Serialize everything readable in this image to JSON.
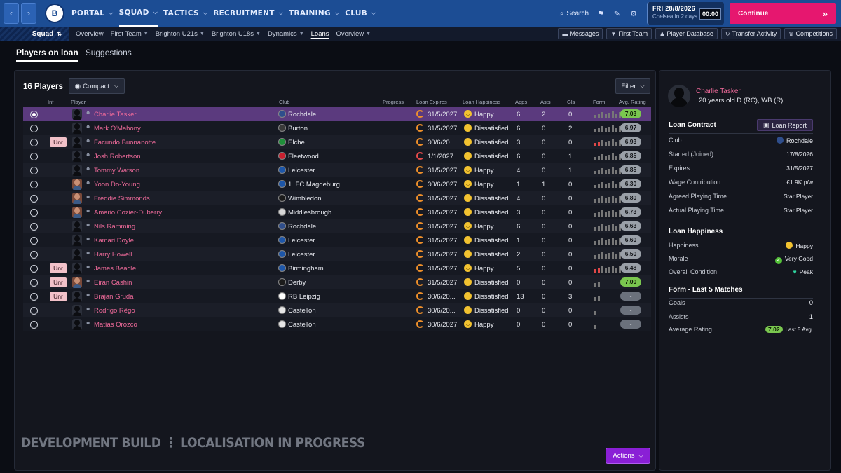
{
  "topnav": {
    "menu": [
      {
        "label": "PORTAL"
      },
      {
        "label": "SQUAD"
      },
      {
        "label": "TACTICS"
      },
      {
        "label": "RECRUITMENT"
      },
      {
        "label": "TRAINING"
      },
      {
        "label": "CLUB"
      }
    ],
    "search_label": "Search",
    "date": "FRI 28/8/2026",
    "date_sub": "Chelsea  In 2 days",
    "clock": "00:00",
    "continue_label": "Continue"
  },
  "subnav": {
    "squad_label": "Squad",
    "links": [
      {
        "label": "Overview"
      },
      {
        "label": "First Team"
      },
      {
        "label": "Brighton U21s"
      },
      {
        "label": "Brighton U18s"
      },
      {
        "label": "Dynamics"
      },
      {
        "label": "Loans"
      },
      {
        "label": "Overview"
      }
    ],
    "buttons": [
      {
        "label": "Messages"
      },
      {
        "label": "First Team"
      },
      {
        "label": "Player Database"
      },
      {
        "label": "Transfer Activity"
      },
      {
        "label": "Competitions"
      }
    ]
  },
  "tabs": [
    {
      "label": "Players on loan"
    },
    {
      "label": "Suggestions"
    }
  ],
  "table": {
    "title": "16 Players",
    "view_label": "Compact",
    "filter_label": "Filter",
    "headers": {
      "inf": "Inf",
      "player": "Player",
      "club": "Club",
      "progress": "Progress",
      "expires": "Loan Expires",
      "happiness": "Loan Happiness",
      "apps": "Apps",
      "asts": "Asts",
      "gls": "Gls",
      "form": "Form",
      "rating": "Avg. Rating"
    },
    "rows": [
      {
        "name": "Charlie Tasker",
        "club": "Rochdale",
        "expires": "31/5/2027",
        "happiness": "Happy",
        "apps": "6",
        "asts": "2",
        "gls": "0",
        "rating": "7.03"
      },
      {
        "name": "Mark O'Mahony",
        "club": "Burton",
        "expires": "31/5/2027",
        "happiness": "Dissatisfied",
        "apps": "6",
        "asts": "0",
        "gls": "2",
        "rating": "6.97"
      },
      {
        "inf": "Unr",
        "name": "Facundo Buonanotte",
        "club": "Elche",
        "expires": "30/6/20...",
        "happiness": "Dissatisfied",
        "apps": "3",
        "asts": "0",
        "gls": "0",
        "rating": "6.93"
      },
      {
        "name": "Josh Robertson",
        "club": "Fleetwood",
        "expires": "1/1/2027",
        "happiness": "Dissatisfied",
        "apps": "6",
        "asts": "0",
        "gls": "1",
        "rating": "6.85"
      },
      {
        "name": "Tommy Watson",
        "club": "Leicester",
        "expires": "31/5/2027",
        "happiness": "Happy",
        "apps": "4",
        "asts": "0",
        "gls": "1",
        "rating": "6.85"
      },
      {
        "name": "Yoon Do-Young",
        "club": "1. FC Magdeburg",
        "expires": "30/6/2027",
        "happiness": "Happy",
        "apps": "1",
        "asts": "1",
        "gls": "0",
        "rating": "6.30"
      },
      {
        "name": "Freddie Simmonds",
        "club": "Wimbledon",
        "expires": "31/5/2027",
        "happiness": "Dissatisfied",
        "apps": "4",
        "asts": "0",
        "gls": "0",
        "rating": "6.80"
      },
      {
        "name": "Amario Cozier-Duberry",
        "club": "Middlesbrough",
        "expires": "31/5/2027",
        "happiness": "Dissatisfied",
        "apps": "3",
        "asts": "0",
        "gls": "0",
        "rating": "6.73"
      },
      {
        "name": "Nils Ramming",
        "club": "Rochdale",
        "expires": "31/5/2027",
        "happiness": "Happy",
        "apps": "6",
        "asts": "0",
        "gls": "0",
        "rating": "6.63"
      },
      {
        "name": "Kamari Doyle",
        "club": "Leicester",
        "expires": "31/5/2027",
        "happiness": "Dissatisfied",
        "apps": "1",
        "asts": "0",
        "gls": "0",
        "rating": "6.60"
      },
      {
        "name": "Harry Howell",
        "club": "Leicester",
        "expires": "31/5/2027",
        "happiness": "Dissatisfied",
        "apps": "2",
        "asts": "0",
        "gls": "0",
        "rating": "6.50"
      },
      {
        "inf": "Unr",
        "name": "James Beadle",
        "club": "Birmingham",
        "expires": "31/5/2027",
        "happiness": "Happy",
        "apps": "5",
        "asts": "0",
        "gls": "0",
        "rating": "6.48"
      },
      {
        "inf": "Unr",
        "name": "Eiran Cashin",
        "club": "Derby",
        "expires": "31/5/2027",
        "happiness": "Dissatisfied",
        "apps": "0",
        "asts": "0",
        "gls": "0",
        "rating": "7.00"
      },
      {
        "inf": "Unr",
        "name": "Brajan Gruda",
        "club": "RB Leipzig",
        "expires": "30/6/20...",
        "happiness": "Dissatisfied",
        "apps": "13",
        "asts": "0",
        "gls": "3",
        "rating": "-"
      },
      {
        "name": "Rodrigo Rêgo",
        "club": "Castellón",
        "expires": "30/6/20...",
        "happiness": "Dissatisfied",
        "apps": "0",
        "asts": "0",
        "gls": "0",
        "rating": "-"
      },
      {
        "name": "Matías Orozco",
        "club": "Castellón",
        "expires": "30/6/2027",
        "happiness": "Happy",
        "apps": "0",
        "asts": "0",
        "gls": "0",
        "rating": "-"
      }
    ]
  },
  "watermark": "DEVELOPMENT BUILD ⋮ LOCALISATION IN PROGRESS",
  "actions_label": "Actions",
  "detail": {
    "name": "Charlie Tasker",
    "sub": "20 years old  D (RC), WB (R)",
    "loan_contract": {
      "title": "Loan Contract",
      "report_label": "Loan Report",
      "rows": [
        {
          "k": "Club",
          "v": "Rochdale"
        },
        {
          "k": "Started (Joined)",
          "v": "17/8/2026"
        },
        {
          "k": "Expires",
          "v": "31/5/2027"
        },
        {
          "k": "Wage Contribution",
          "v": "£1.9K p/w"
        },
        {
          "k": "Agreed Playing Time",
          "v": "Star Player"
        },
        {
          "k": "Actual Playing Time",
          "v": "Star Player"
        }
      ]
    },
    "loan_happiness": {
      "title": "Loan Happiness",
      "rows": [
        {
          "k": "Happiness",
          "v": "Happy"
        },
        {
          "k": "Morale",
          "v": "Very Good"
        },
        {
          "k": "Overall Condition",
          "v": "Peak"
        }
      ]
    },
    "form": {
      "title": "Form - Last 5 Matches",
      "rows": [
        {
          "k": "Goals",
          "v": "0"
        },
        {
          "k": "Assists",
          "v": "1"
        },
        {
          "k": "Average Rating",
          "pill": "7.02",
          "v": "Last 5 Avg."
        }
      ]
    }
  }
}
